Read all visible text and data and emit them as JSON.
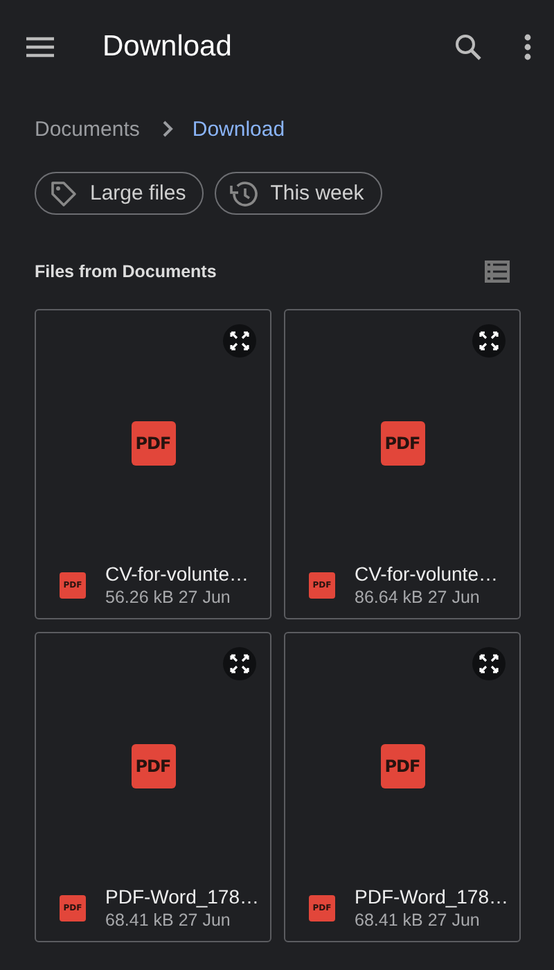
{
  "app_bar": {
    "title": "Download"
  },
  "breadcrumb": [
    {
      "label": "Documents",
      "selected": false
    },
    {
      "label": "Download",
      "selected": true
    }
  ],
  "chips": [
    {
      "label": "Large files",
      "kind": "tag"
    },
    {
      "label": "This week",
      "kind": "history"
    }
  ],
  "section": {
    "title": "Files from Documents"
  },
  "files": [
    {
      "name": "CV-for-volunte…",
      "size": "56.26 kB",
      "date": "27 Jun",
      "thumb_badge": "PDF",
      "icon_badge": "PDF"
    },
    {
      "name": "CV-for-volunte…",
      "size": "86.64 kB",
      "date": "27 Jun",
      "thumb_badge": "PDF",
      "icon_badge": "PDF"
    },
    {
      "name": "PDF-Word_178…",
      "size": "68.41 kB",
      "date": "27 Jun",
      "thumb_badge": "PDF",
      "icon_badge": "PDF"
    },
    {
      "name": "PDF-Word_178…",
      "size": "68.41 kB",
      "date": "27 Jun",
      "thumb_badge": "PDF",
      "icon_badge": "PDF"
    }
  ]
}
